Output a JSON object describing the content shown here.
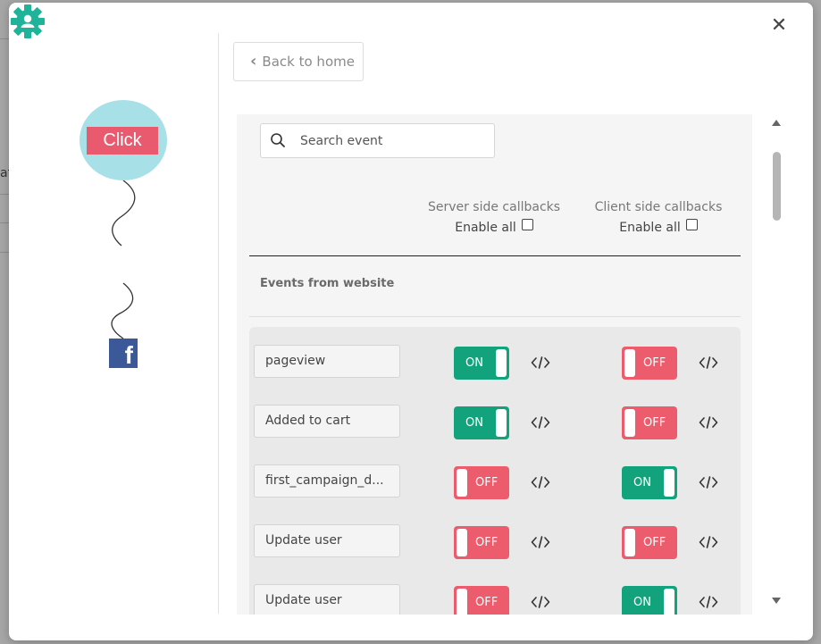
{
  "background": {
    "fragment": "at"
  },
  "modal": {
    "close_label": "✕"
  },
  "flow": {
    "click_label": "Click",
    "facebook_letter": "f"
  },
  "back_button": {
    "chevron": "‹",
    "label": "Back to home"
  },
  "search": {
    "placeholder": "Search event",
    "value": ""
  },
  "columns": {
    "server": {
      "title": "Server side callbacks",
      "enable_all": "Enable all"
    },
    "client": {
      "title": "Client side callbacks",
      "enable_all": "Enable all"
    }
  },
  "section_title": "Events from website",
  "events": [
    {
      "name": "pageview",
      "server": "ON",
      "client": "OFF"
    },
    {
      "name": "Added to cart",
      "server": "ON",
      "client": "OFF"
    },
    {
      "name": "first_campaign_d...",
      "server": "OFF",
      "client": "ON"
    },
    {
      "name": "Update user",
      "server": "OFF",
      "client": "OFF"
    },
    {
      "name": "Update user",
      "server": "OFF",
      "client": "ON"
    }
  ],
  "colors": {
    "on": "#12a37c",
    "off": "#ec5c6c",
    "click_bg": "#ea5a6e",
    "circle": "#a8e0e8",
    "gear": "#1fb39a",
    "facebook": "#3b5998"
  }
}
